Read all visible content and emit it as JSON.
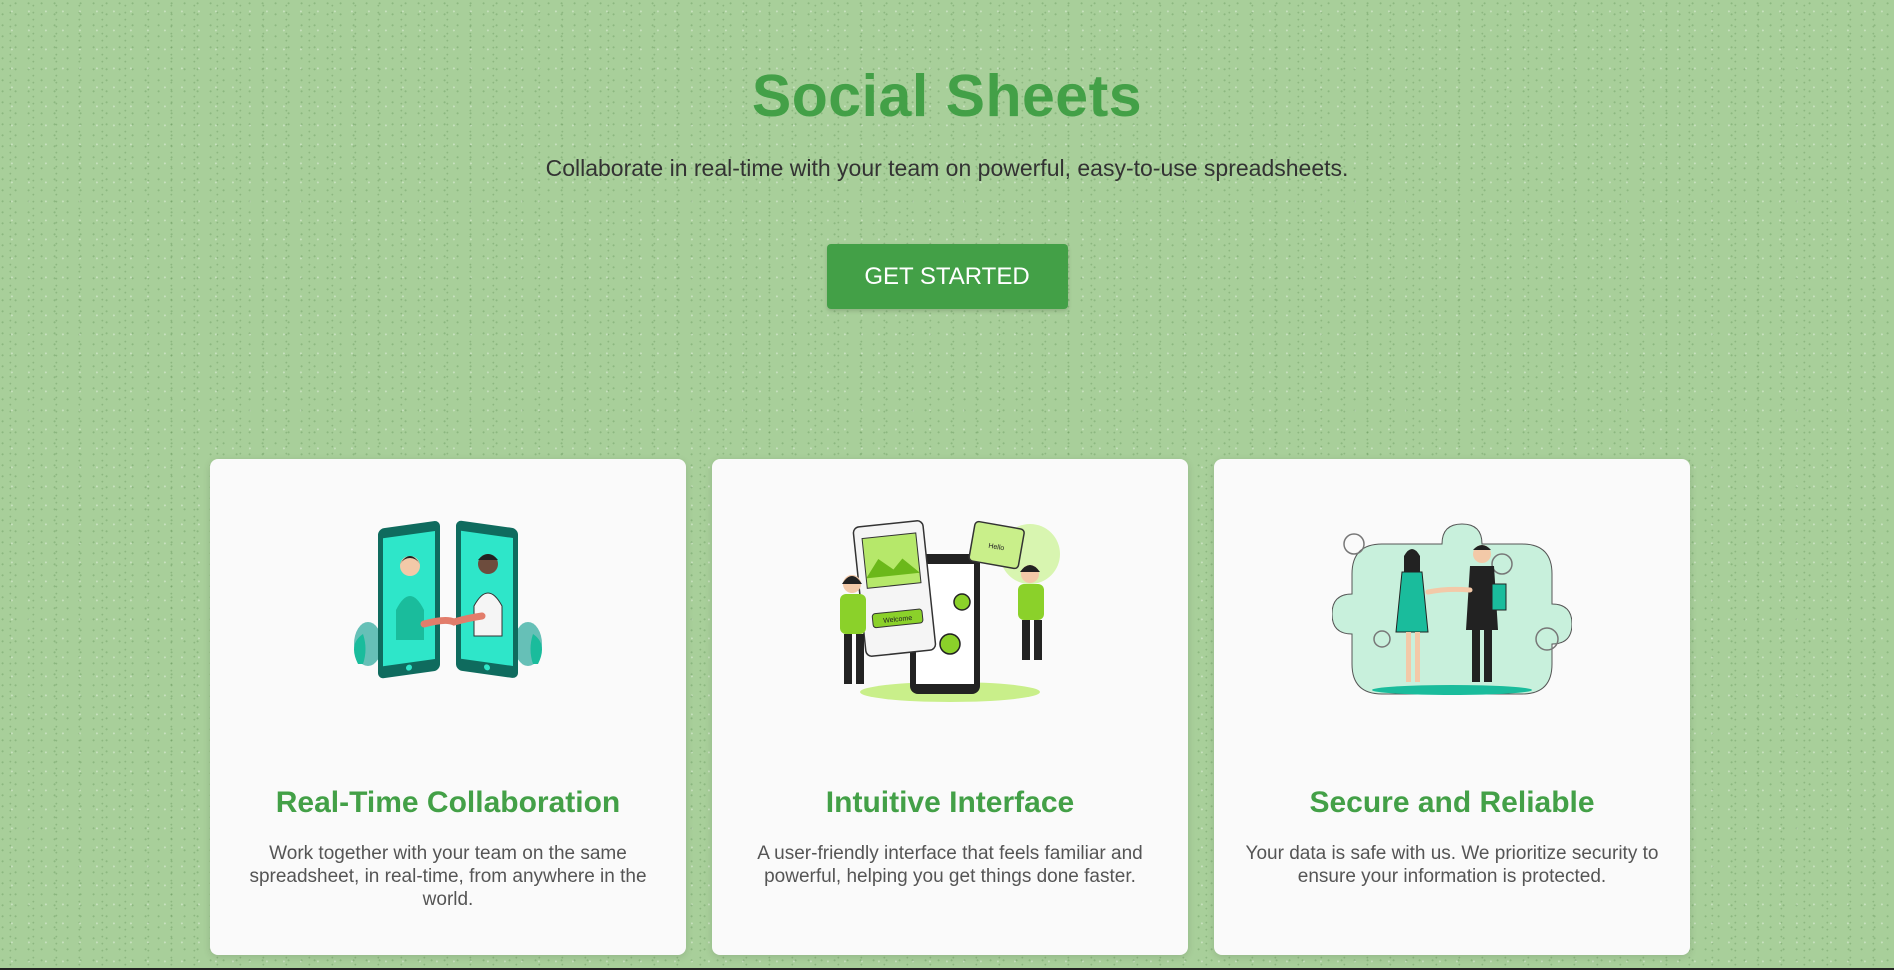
{
  "hero": {
    "title": "Social Sheets",
    "subtitle": "Collaborate in real-time with your team on powerful, easy-to-use spreadsheets.",
    "cta_label": "GET STARTED"
  },
  "features": [
    {
      "title": "Real-Time Collaboration",
      "description": "Work together with your team on the same spreadsheet, in real-time, from anywhere in the world.",
      "illustration": "handshake-phones-icon"
    },
    {
      "title": "Intuitive Interface",
      "description": "A user-friendly interface that feels familiar and powerful, helping you get things done faster.",
      "illustration": "app-interface-icon",
      "illustration_text": [
        "Welcome",
        "Hello"
      ]
    },
    {
      "title": "Secure and Reliable",
      "description": "Your data is safe with us. We prioritize security to ensure your information is protected.",
      "illustration": "puzzle-handshake-icon"
    }
  ],
  "colors": {
    "accent": "#43a047",
    "background": "#a8cf9a",
    "card": "#fafafa",
    "illustration_teal": "#1abc9c",
    "illustration_lime": "#8bd12a"
  }
}
